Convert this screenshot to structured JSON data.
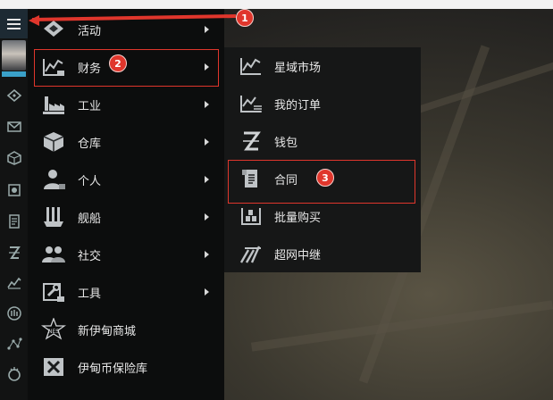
{
  "menu": {
    "items": [
      {
        "label": "活动",
        "icon": "activity-icon",
        "has_submenu": true
      },
      {
        "label": "财务",
        "icon": "finance-chart-icon",
        "has_submenu": true
      },
      {
        "label": "工业",
        "icon": "industry-factory-icon",
        "has_submenu": true
      },
      {
        "label": "仓库",
        "icon": "warehouse-cube-icon",
        "has_submenu": true
      },
      {
        "label": "个人",
        "icon": "person-icon",
        "has_submenu": true
      },
      {
        "label": "舰船",
        "icon": "ship-icon",
        "has_submenu": true
      },
      {
        "label": "社交",
        "icon": "social-people-icon",
        "has_submenu": true
      },
      {
        "label": "工具",
        "icon": "tools-icon",
        "has_submenu": true
      },
      {
        "label": "新伊甸商城",
        "icon": "nes-store-icon",
        "has_submenu": false
      },
      {
        "label": "伊甸币保险库",
        "icon": "plex-vault-icon",
        "has_submenu": false
      }
    ]
  },
  "submenu": {
    "items": [
      {
        "label": "星域市场",
        "icon": "market-chart-icon"
      },
      {
        "label": "我的订单",
        "icon": "orders-chart-icon"
      },
      {
        "label": "钱包",
        "icon": "wallet-isk-icon"
      },
      {
        "label": "合同",
        "icon": "contract-scroll-icon"
      },
      {
        "label": "批量购买",
        "icon": "bulk-buy-icon"
      },
      {
        "label": "超网中继",
        "icon": "hypernet-relay-icon"
      }
    ]
  },
  "annotations": {
    "badge1": "1",
    "badge2": "2",
    "badge3": "3",
    "color": "#e0362c"
  }
}
